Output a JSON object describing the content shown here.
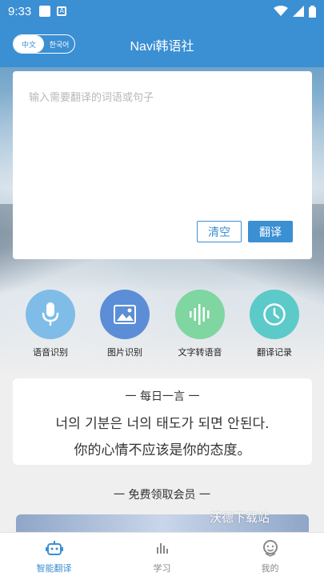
{
  "status_bar": {
    "time": "9:33",
    "notif_icon_label": "A"
  },
  "header": {
    "lang_left": "中文",
    "lang_right": "한국어",
    "title": "Navi韩语社"
  },
  "translate": {
    "placeholder": "输入需要翻译的词语或句子",
    "clear_label": "清空",
    "translate_label": "翻译"
  },
  "features": [
    {
      "label": "语音识别",
      "color": "#7fbde8",
      "icon": "microphone-icon"
    },
    {
      "label": "图片识别",
      "color": "#5b8ed6",
      "icon": "image-icon"
    },
    {
      "label": "文字转语音",
      "color": "#7fd6a0",
      "icon": "soundwave-icon"
    },
    {
      "label": "翻译记录",
      "color": "#5ccac9",
      "icon": "clock-icon"
    }
  ],
  "quote": {
    "title": "一  每日一言  一",
    "korean": "너의 기분은 너의 태도가 되면 안된다.",
    "chinese": "你的心情不应该是你的态度。"
  },
  "member": {
    "title": "一  免费领取会员  一",
    "watermark": "沃德下载站"
  },
  "nav": [
    {
      "label": "智能翻译",
      "icon": "robot-icon",
      "active": true
    },
    {
      "label": "学习",
      "icon": "bars-icon",
      "active": false
    },
    {
      "label": "我的",
      "icon": "smile-icon",
      "active": false
    }
  ],
  "colors": {
    "accent": "#3b8fd3",
    "background": "#efefef"
  }
}
